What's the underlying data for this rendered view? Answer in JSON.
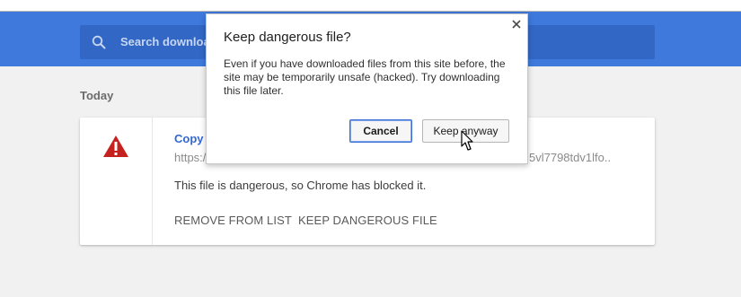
{
  "search": {
    "placeholder": "Search download"
  },
  "section": {
    "today_label": "Today"
  },
  "download_item": {
    "file_name": "Copy c",
    "url_start": "https:/",
    "url_end": "5vl7798tdv1lfo..",
    "status_text": "This file is dangerous, so Chrome has blocked it.",
    "remove_label": "REMOVE FROM LIST",
    "keep_label": "KEEP DANGEROUS FILE",
    "warning_icon": "warning-triangle-icon"
  },
  "dialog": {
    "title": "Keep dangerous file?",
    "body_line1": "Even if you have downloaded files from this site before, the",
    "body_line2": "site may be temporarily unsafe (hacked). Try downloading",
    "body_line3": "this file later.",
    "cancel_label": "Cancel",
    "keep_label": "Keep anyway",
    "close_icon": "close-icon"
  },
  "colors": {
    "header": "#3e79db",
    "search_box": "#3367c5",
    "link_blue": "#3367d6",
    "warning_red": "#c5221f"
  }
}
